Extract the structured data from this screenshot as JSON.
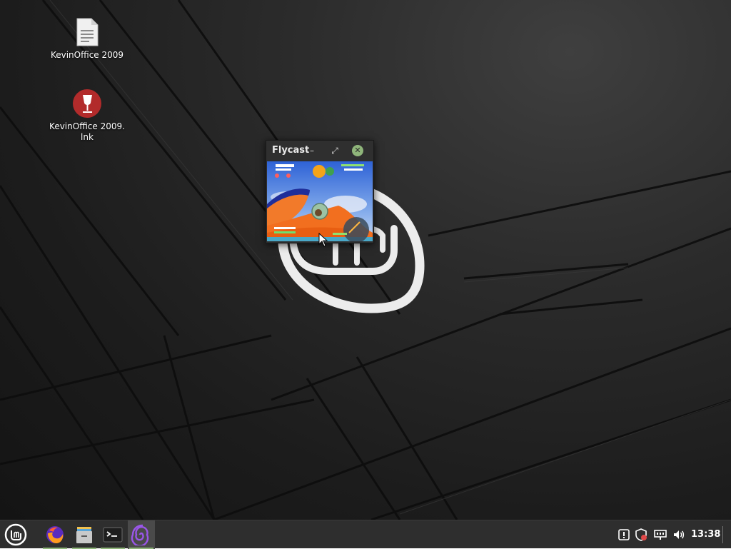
{
  "desktop": {
    "icons": [
      {
        "label": "KevinOffice 2009",
        "icon": "document-icon"
      },
      {
        "label": "KevinOffice 2009.\nlnk",
        "icon": "wine-glass-icon"
      }
    ]
  },
  "flycast_window": {
    "title": "Flycast",
    "minimize_glyph": "–",
    "maximize_glyph": "⤢",
    "close_glyph": "✕"
  },
  "panel": {
    "menu_icon": "linux-mint-logo-icon",
    "launchers": [
      {
        "app": "Firefox",
        "icon": "firefox-icon"
      },
      {
        "app": "Files",
        "icon": "file-manager-icon"
      },
      {
        "app": "Terminal",
        "icon": "terminal-icon"
      },
      {
        "app": "Flycast",
        "icon": "flycast-swirl-icon",
        "active": true
      }
    ],
    "tray": [
      "notification-icon",
      "update-shield-icon",
      "network-icon",
      "volume-icon"
    ],
    "clock": "13:38"
  },
  "colors": {
    "panel_bg": "#2e2e2e",
    "accent": "#8fb57a",
    "window_bg": "#2f2f2f"
  }
}
